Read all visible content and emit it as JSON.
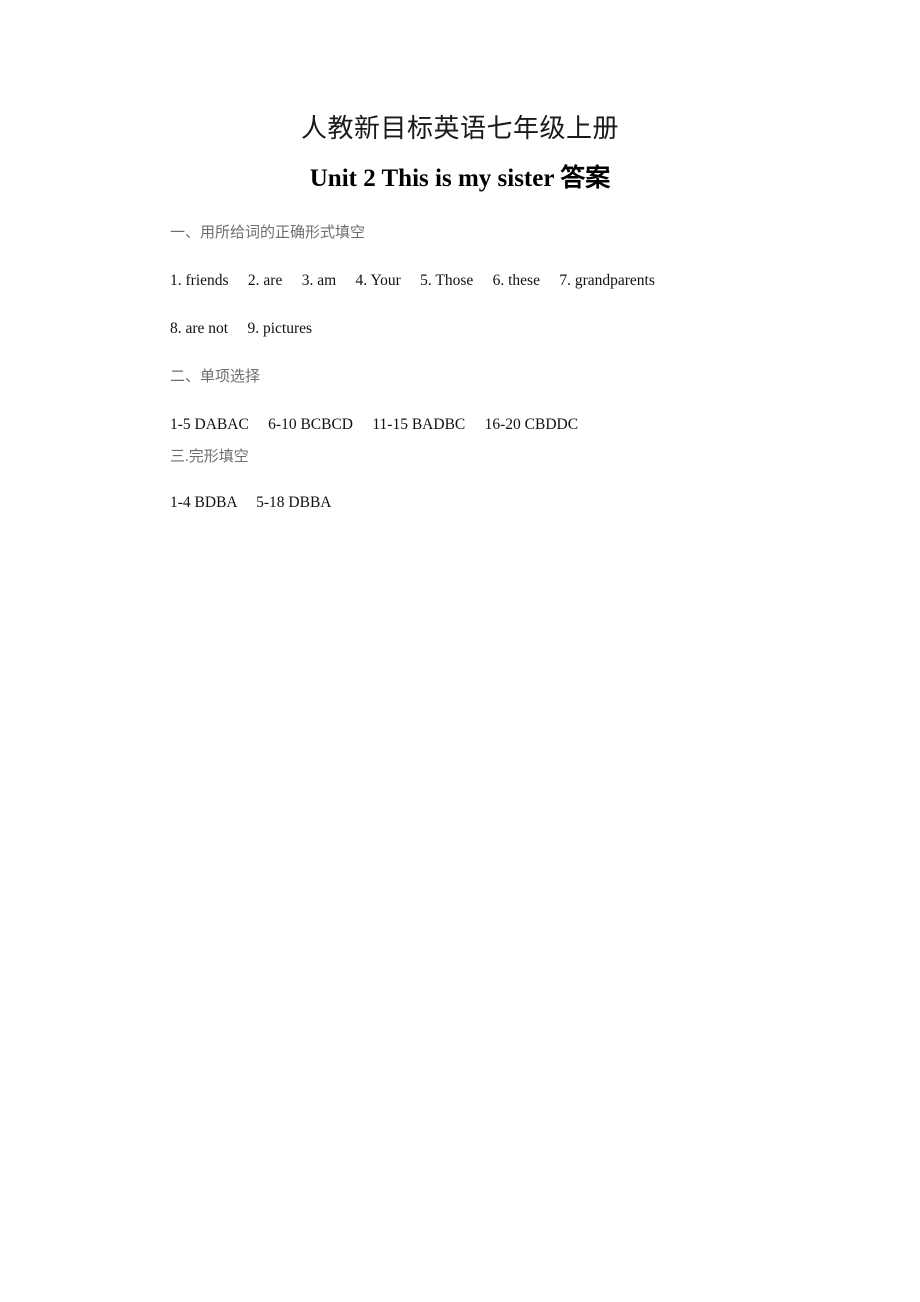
{
  "document": {
    "title_line_1": "人教新目标英语七年级上册",
    "title_line_2": "Unit 2 This is my sister 答案",
    "sections": [
      {
        "heading": "一、用所给词的正确形式填空",
        "lines": [
          "1. friends     2. are     3. am     4. Your     5. Those     6. these     7. grandparents",
          "8. are not     9. pictures"
        ]
      },
      {
        "heading": "二、单项选择",
        "lines": [
          "1-5 DABAC     6-10 BCBCD     11-15 BADBC     16-20 CBDDC"
        ]
      },
      {
        "heading": "三.完形填空",
        "lines": [
          "1-4 BDBA     5-18 DBBA"
        ]
      }
    ]
  }
}
